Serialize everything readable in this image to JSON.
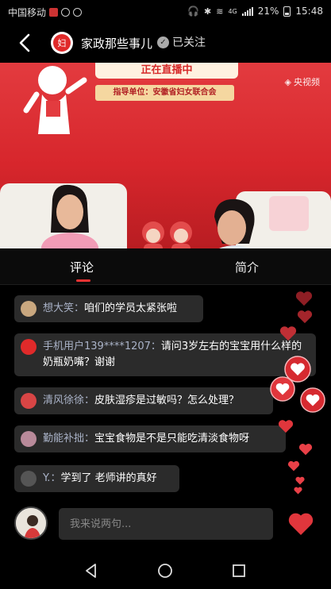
{
  "status_bar": {
    "carrier": "中国移动",
    "battery": "21%",
    "time": "15:48",
    "network": "4G"
  },
  "header": {
    "channel_name": "家政那些事儿",
    "follow_label": "已关注",
    "logo_text": "妇"
  },
  "video": {
    "banner": "正在直播中",
    "guide_text": "指导单位：安徽省妇女联合会",
    "source": "央视频"
  },
  "tabs": {
    "comments": "评论",
    "intro": "简介"
  },
  "comments": [
    {
      "name": "想大笑：",
      "text": "咱们的学员太紧张啦",
      "avatar_color": "#c9a77f"
    },
    {
      "name": "手机用户139****1207：",
      "text": "请问3岁左右的宝宝用什么样的奶瓶奶嘴？谢谢",
      "avatar_color": "#e02a2a"
    },
    {
      "name": "清风徐徐：",
      "text": "皮肤湿疹是过敏吗？怎么处理？",
      "avatar_color": "#d84545"
    },
    {
      "name": "勤能补拙：",
      "text": "宝宝食物是不是只能吃清淡食物呀",
      "avatar_color": "#b98a9a"
    },
    {
      "name": "Y.：",
      "text": "学到了 老师讲的真好",
      "avatar_color": "#555555"
    }
  ],
  "input": {
    "placeholder": "我来说两句..."
  },
  "colors": {
    "accent": "#e33b3f",
    "bubble": "#2b2b2b",
    "username": "#aab3c8"
  }
}
